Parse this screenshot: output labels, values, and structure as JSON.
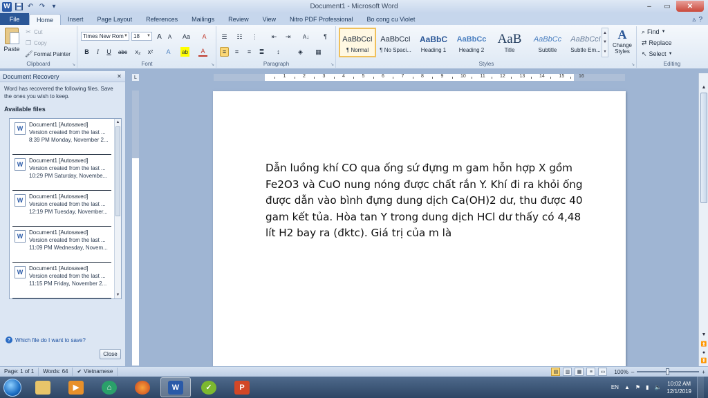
{
  "window": {
    "title": "Document1 - Microsoft Word",
    "app_icon": "W",
    "minimize": "–",
    "restore": "▭",
    "close": "✕"
  },
  "qat": {
    "save_icon": "💾",
    "undo_icon": "↶",
    "redo_icon": "↷",
    "customize_icon": "▾"
  },
  "tabs": [
    {
      "label": "File"
    },
    {
      "label": "Home"
    },
    {
      "label": "Insert"
    },
    {
      "label": "Page Layout"
    },
    {
      "label": "References"
    },
    {
      "label": "Mailings"
    },
    {
      "label": "Review"
    },
    {
      "label": "View"
    },
    {
      "label": "Nitro PDF Professional"
    },
    {
      "label": "Bo cong cu Violet"
    }
  ],
  "tab_right": {
    "minimize_ribbon": "▵",
    "help": "?"
  },
  "ribbon": {
    "clipboard": {
      "label": "Clipboard",
      "paste": "Paste",
      "cut": "Cut",
      "copy": "Copy",
      "format_painter": "Format Painter"
    },
    "font": {
      "label": "Font",
      "font_name": "Times New Rom",
      "font_size": "18",
      "grow": "A",
      "shrink": "A",
      "case": "Aa",
      "clear": "A",
      "bold": "B",
      "italic": "I",
      "underline": "U",
      "strike": "abc",
      "subscript": "x₂",
      "superscript": "x²",
      "effects": "A",
      "highlight": "ab",
      "font_color": "A"
    },
    "paragraph": {
      "label": "Paragraph",
      "pilcrow": "¶",
      "sort": "A↓"
    },
    "styles": {
      "label": "Styles",
      "items": [
        {
          "sample": "AaBbCcI",
          "name": "¶ Normal"
        },
        {
          "sample": "AaBbCcI",
          "name": "¶ No Spaci..."
        },
        {
          "sample": "AaBbC",
          "name": "Heading 1"
        },
        {
          "sample": "AaBbCc",
          "name": "Heading 2"
        },
        {
          "sample": "AaB",
          "name": "Title"
        },
        {
          "sample": "AaBbCc",
          "name": "Subtitle"
        },
        {
          "sample": "AaBbCcI",
          "name": "Subtle Em..."
        }
      ],
      "change_styles": "Change Styles"
    },
    "editing": {
      "label": "Editing",
      "find": "Find",
      "replace": "Replace",
      "select": "Select"
    }
  },
  "recovery": {
    "title": "Document Recovery",
    "description": "Word has recovered the following files.  Save the ones you wish to keep.",
    "available": "Available files",
    "files": [
      {
        "name": "Document1  [Autosaved]",
        "line1": "Version created from the last ...",
        "line2": "8:39 PM Monday, November 2..."
      },
      {
        "name": "Document1  [Autosaved]",
        "line1": "Version created from the last ...",
        "line2": "10:29 PM Saturday, Novembe..."
      },
      {
        "name": "Document1  [Autosaved]",
        "line1": "Version created from the last ...",
        "line2": "12:19 PM Tuesday, November..."
      },
      {
        "name": "Document1  [Autosaved]",
        "line1": "Version created from the last ...",
        "line2": "11:09 PM Wednesday, Novem..."
      },
      {
        "name": "Document1  [Autosaved]",
        "line1": "Version created from the last ...",
        "line2": "11:15 PM Friday, November 2..."
      }
    ],
    "help_link": "Which file do I want to save?",
    "close_button": "Close"
  },
  "ruler": {
    "numbers": [
      "1",
      "2",
      "3",
      "4",
      "5",
      "6",
      "7",
      "8",
      "9",
      "10",
      "11",
      "12",
      "13",
      "14",
      "15",
      "16"
    ]
  },
  "document": {
    "text": "Dẫn luồng khí CO qua ống sứ đựng m gam hỗn hợp X gồm Fe2O3 và CuO nung nóng được chất rắn Y. Khí đi ra khỏi ống được dẫn vào bình đựng dung dịch Ca(OH)2 dư, thu được 40 gam kết tủa. Hòa tan Y trong dung dịch HCl dư thấy có 4,48 lít H2 bay ra (đktc). Giá trị của m là"
  },
  "status": {
    "page": "Page: 1 of 1",
    "words": "Words: 64",
    "language": "Vietnamese",
    "zoom": "100%",
    "zoom_out": "–",
    "zoom_in": "+"
  },
  "taskbar": {
    "tray_lang": "EN",
    "time": "10:02 AM",
    "date": "12/1/2019"
  },
  "colors": {
    "file_tab": "#2b5797",
    "ribbon_bg": "#dde8f4",
    "workspace": "#9fb5d3",
    "selected_style": "#f0c05a"
  }
}
